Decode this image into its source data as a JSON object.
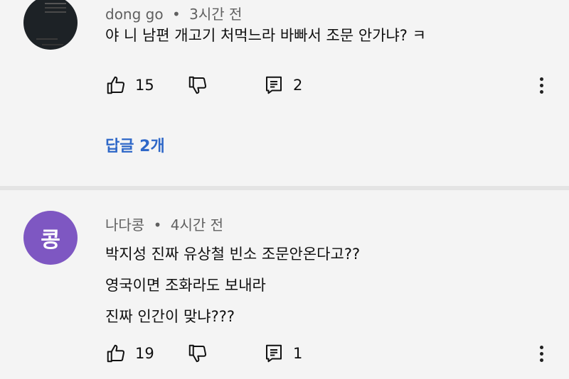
{
  "comments": [
    {
      "author": "dong go",
      "separator": "•",
      "time": "3시간 전",
      "lines": [
        "야 니 남편 개고기 처먹느라 바빠서 조문 안가냐? ㅋ"
      ],
      "likes": "15",
      "replies_count": "2",
      "replies_link": "답글 2개"
    },
    {
      "author": "나다콩",
      "separator": "•",
      "time": "4시간 전",
      "avatar_letter": "콩",
      "avatar_color": "#7e57c2",
      "lines": [
        "박지성 진짜 유상철 빈소 조문안온다고??",
        "영국이면 조화라도 보내라",
        "진짜 인간이 맞냐???"
      ],
      "likes": "19",
      "replies_count": "1"
    }
  ],
  "icons": {
    "like": "thumbs-up-icon",
    "dislike": "thumbs-down-icon",
    "reply": "reply-comment-icon",
    "more": "more-vertical-icon"
  },
  "colors": {
    "link": "#2f68c8",
    "meta": "#606060",
    "background": "#f4f4f4"
  }
}
